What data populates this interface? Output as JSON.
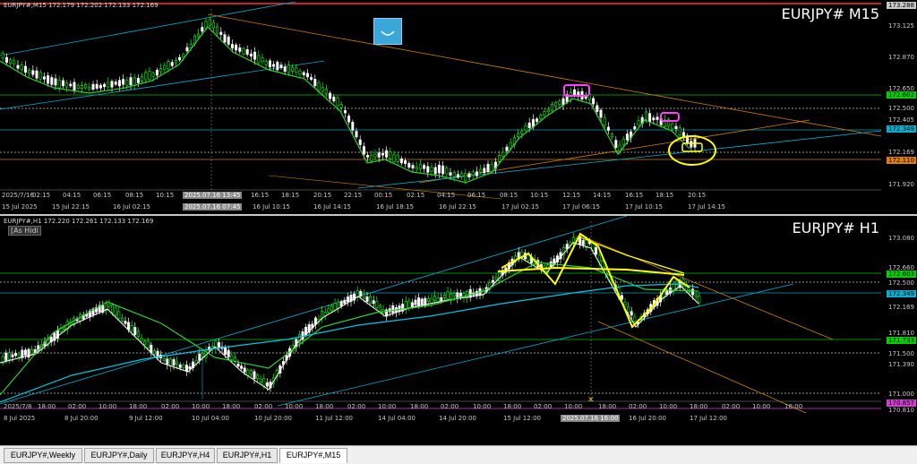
{
  "top_chart": {
    "header": "EURJPY#,M15 172.179 172.202 172.133 172.169",
    "symbol_label": "EURJPY# M15",
    "price_labels": [
      {
        "text": "173.288",
        "color": "#ffffff",
        "bg": "#c8c8c8"
      },
      {
        "text": "173.125",
        "color": "",
        "bg": ""
      },
      {
        "text": "172.870",
        "color": "",
        "bg": ""
      },
      {
        "text": "172.650",
        "color": "",
        "bg": ""
      },
      {
        "text": "172.602",
        "color": "",
        "bg": "#00d000"
      },
      {
        "text": "172.500",
        "color": "",
        "bg": ""
      },
      {
        "text": "172.405",
        "color": "",
        "bg": ""
      },
      {
        "text": "172.349",
        "color": "",
        "bg": "#00b0d0"
      },
      {
        "text": "172.169",
        "color": "",
        "bg": ""
      },
      {
        "text": "172.110",
        "color": "",
        "bg": "#e08000"
      },
      {
        "text": "171.920",
        "color": "",
        "bg": ""
      }
    ],
    "time_labels_row1": [
      "2025/7/16",
      "02:15",
      "04:15",
      "06:15",
      "08:15",
      "10:15",
      "2025.07.16 13:45",
      "16:15",
      "18:15",
      "20:15",
      "22:15",
      "00:15",
      "02:15",
      "04:15",
      "06:15",
      "08:15",
      "10:15",
      "12:15",
      "14:15",
      "16:15",
      "18:15",
      "20:15"
    ],
    "time_labels_row2": [
      "15 Jul 2025",
      "15 Jul 22:15",
      "16 Jul 02:15",
      "2025.07.16 07:45",
      "16 Jul 10:15",
      "16 Jul 14:15",
      "16 Jul 18:15",
      "16 Jul 22:15",
      "17 Jul 02:15",
      "17 Jul 06:15",
      "17 Jul 10:15",
      "17 Jul 14:15"
    ]
  },
  "bottom_chart": {
    "header": "EURJPY#,H1 172.220 172.261 172.133 172.169",
    "symbol_label": "EURJPY# H1",
    "badge": "[As Hidi",
    "price_labels": [
      {
        "text": "173.080",
        "color": "",
        "bg": ""
      },
      {
        "text": "172.660",
        "color": "",
        "bg": ""
      },
      {
        "text": "172.603",
        "color": "",
        "bg": "#00d000"
      },
      {
        "text": "172.500",
        "color": "",
        "bg": ""
      },
      {
        "text": "172.349",
        "color": "",
        "bg": "#00b0d0"
      },
      {
        "text": "172.169",
        "color": "",
        "bg": ""
      },
      {
        "text": "171.810",
        "color": "",
        "bg": ""
      },
      {
        "text": "171.733",
        "color": "",
        "bg": "#00d000"
      },
      {
        "text": "171.500",
        "color": "",
        "bg": ""
      },
      {
        "text": "171.390",
        "color": "",
        "bg": ""
      },
      {
        "text": "171.000",
        "color": "",
        "bg": ""
      },
      {
        "text": "170.857",
        "color": "",
        "bg": "#d040d0"
      },
      {
        "text": "170.810",
        "color": "",
        "bg": ""
      }
    ],
    "time_labels_row1": [
      "2025/7/8",
      "18:00",
      "02:00",
      "10:00",
      "18:00",
      "02:00",
      "10:00",
      "18:00",
      "02:00",
      "10:00",
      "18:00",
      "02:00",
      "10:00",
      "18:00",
      "02:00",
      "10:00",
      "18:00",
      "02:00",
      "10:00",
      "18:00",
      "02:00",
      "10:00",
      "18:00",
      "02:00",
      "10:00",
      "18:00"
    ],
    "time_labels_row2": [
      "8 Jul 2025",
      "8 Jul 20:00",
      "9 Jul 12:00",
      "10 Jul 04:00",
      "10 Jul 20:00",
      "11 Jul 12:00",
      "14 Jul 04:00",
      "14 Jul 20:00",
      "15 Jul 12:00",
      "2025.07.16 16:00",
      "16 Jul 20:00",
      "17 Jul 12:00"
    ]
  },
  "tabs": [
    "EURJPY#,Weekly",
    "EURJPY#,Daily",
    "EURJPY#,H4",
    "EURJPY#,H1",
    "EURJPY#,M15"
  ],
  "active_tab": "EURJPY#,M15"
}
